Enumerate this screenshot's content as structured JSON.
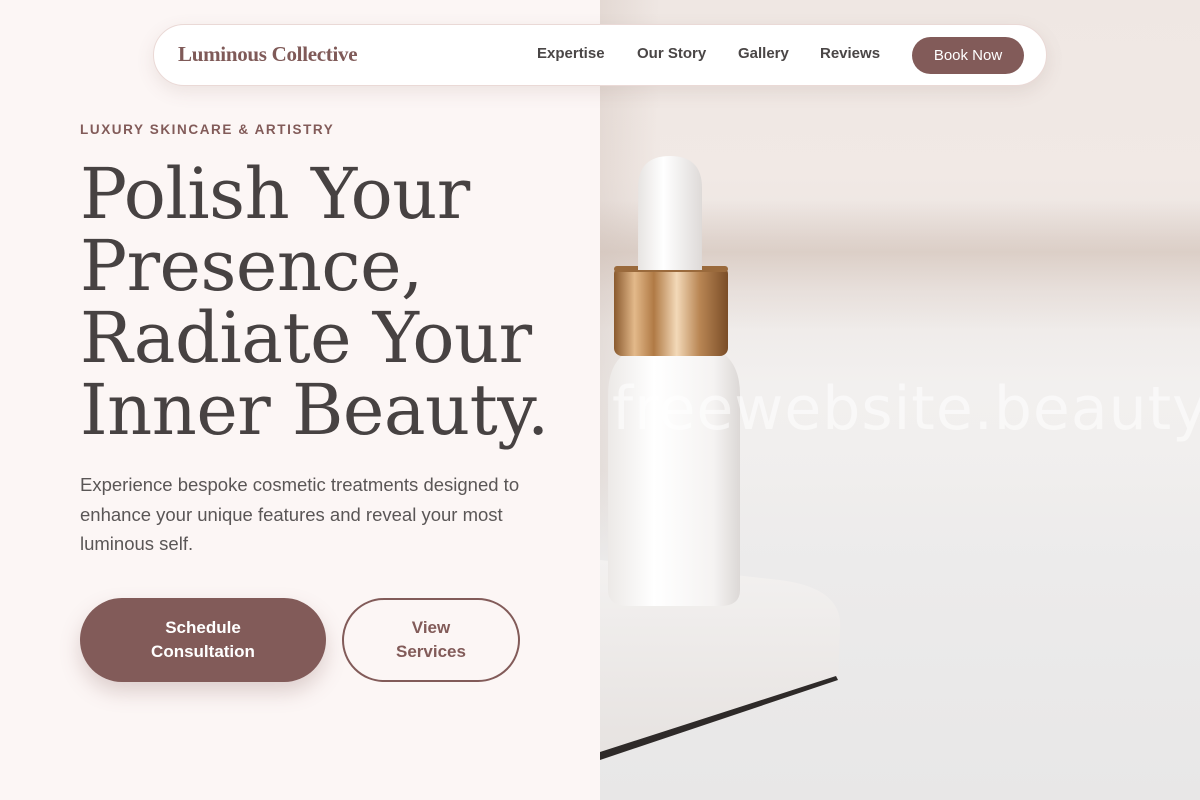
{
  "nav": {
    "brand": "Luminous Collective",
    "links": [
      "Expertise",
      "Our Story",
      "Gallery",
      "Reviews"
    ],
    "cta": "Book Now"
  },
  "hero": {
    "eyebrow": "LUXURY SKINCARE & ARTISTRY",
    "headline_lines": [
      "Polish Your",
      "Presence,",
      "Radiate Your",
      "Inner Beauty."
    ],
    "intro": "Experience bespoke cosmetic treatments designed to enhance your unique features and reveal your most luminous self.",
    "primary_button": "Schedule Consultation",
    "secondary_button": "View Services"
  },
  "image": {
    "watermark": "freewebsite.beauty"
  },
  "colors": {
    "accent": "#825b59",
    "background": "#fcf6f5",
    "heading": "#474242"
  }
}
